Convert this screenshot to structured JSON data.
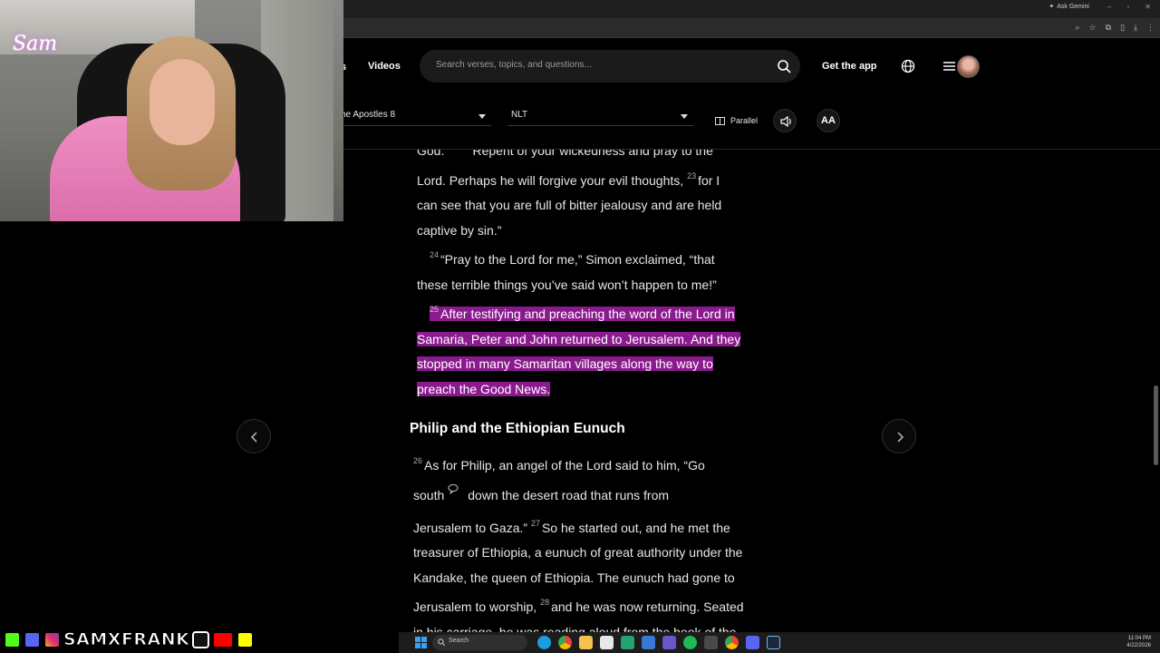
{
  "browser": {
    "gemini_label": "Ask Gemini",
    "window_controls": [
      "–",
      "▫",
      "✕"
    ]
  },
  "header": {
    "nav_partial": "s",
    "videos_label": "Videos",
    "search_placeholder": "Search verses, topics, and questions...",
    "get_app_label": "Get the app"
  },
  "toolbar": {
    "book_selector": "he Apostles 8",
    "version_selector": "NLT",
    "parallel_label": "Parallel",
    "font_label": "AA"
  },
  "passage": {
    "line_top_a": "God.",
    "line_top_b": "Repent of your wickedness and pray to the",
    "v22_tail": "Lord. Perhaps he will forgive your evil thoughts,",
    "v23_num": "23",
    "v23_text_a": "for I",
    "v23_text_b": "can see that you are full of bitter jealousy and are held",
    "v23_text_c": "captive by sin.”",
    "v24_num": "24",
    "v24_text": "“Pray to the Lord for me,” Simon exclaimed, “that these terrible things you’ve said won’t happen to me!”",
    "v25_num": "25",
    "v25_text": "After testifying and preaching the word of the Lord in Samaria, Peter and John returned to Jerusalem. And they stopped in many Samaritan villages along the way to preach the Good News.",
    "section_heading": "Philip and the Ethiopian Eunuch",
    "v26_num": "26",
    "v26_text_a": "As for Philip, an angel of the Lord said to him, “Go",
    "v26_text_b": "south",
    "v26_text_c": "down the desert road that runs from",
    "v26_text_d": "Jerusalem to Gaza.”",
    "v27_num": "27",
    "v27_text": "So he started out, and he met the treasurer of Ethiopia, a eunuch of great authority under the Kandake, the queen of Ethiopia. The eunuch had gone to Jerusalem to worship,",
    "v28_num": "28",
    "v28_text": "and he was now returning. Seated in his carriage, he was reading aloud from the book of the prophet Isaiah."
  },
  "overlay": {
    "logo_text": "Sam",
    "social_handle": "SAMXFRANK"
  },
  "taskbar": {
    "search_label": "Search",
    "time": "11:04 PM",
    "date": "4/22/2026"
  },
  "colors": {
    "highlight": "#8b1a8e",
    "background": "#000000"
  }
}
